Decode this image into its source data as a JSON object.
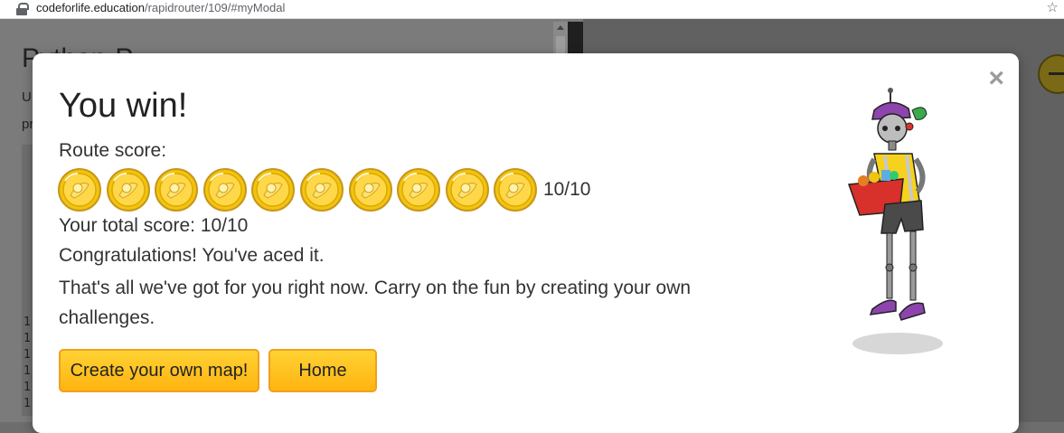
{
  "browser": {
    "url_host": "codeforlife.education",
    "url_path": "/rapidrouter/109/#myModal"
  },
  "background": {
    "title_partial": "P",
    "title_partial_2": "P",
    "text_partial_1": "U",
    "text_partial_2": "pr",
    "line_numbers": [
      "1",
      "1",
      "1",
      "1",
      "1",
      "1"
    ]
  },
  "modal": {
    "close_label": "×",
    "title": "You win!",
    "route_score_label": "Route score:",
    "route_score": 10,
    "route_score_max": 10,
    "route_score_text": "10/10",
    "total_score_text": "Your total score: 10/10",
    "congrats": "Congratulations! You've aced it.",
    "message": "That's all we've got for you right now. Carry on the fun by creating your own challenges.",
    "buttons": {
      "create_map": "Create your own map!",
      "home": "Home"
    }
  },
  "colors": {
    "coin_gold": "#f5c400",
    "button_gold": "#ffc125",
    "button_border": "#f0a020"
  },
  "icons": {
    "coin": "gold-coin-icon",
    "close": "close-icon",
    "lock": "lock-icon",
    "star": "star-icon"
  }
}
